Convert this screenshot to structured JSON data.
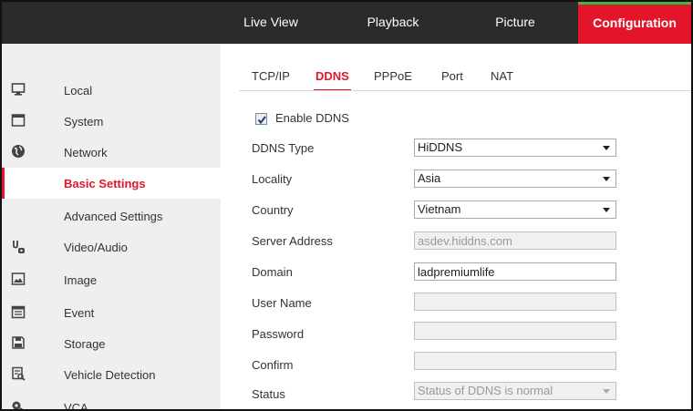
{
  "topnav": {
    "tabs": [
      {
        "label": "Live View"
      },
      {
        "label": "Playback"
      },
      {
        "label": "Picture"
      },
      {
        "label": "Configuration"
      }
    ],
    "active_color": "#e4152a"
  },
  "sidebar": {
    "items": [
      {
        "label": "Local",
        "icon": "monitor-icon"
      },
      {
        "label": "System",
        "icon": "system-icon"
      },
      {
        "label": "Network",
        "icon": "globe-icon"
      },
      {
        "label": "Basic Settings",
        "icon": ""
      },
      {
        "label": "Advanced Settings",
        "icon": ""
      },
      {
        "label": "Video/Audio",
        "icon": "video-audio-icon"
      },
      {
        "label": "Image",
        "icon": "image-icon"
      },
      {
        "label": "Event",
        "icon": "calendar-icon"
      },
      {
        "label": "Storage",
        "icon": "storage-icon"
      },
      {
        "label": "Vehicle Detection",
        "icon": "vehicle-detection-icon"
      },
      {
        "label": "VCA",
        "icon": "vca-icon"
      }
    ]
  },
  "subtabs": [
    {
      "label": "TCP/IP"
    },
    {
      "label": "DDNS"
    },
    {
      "label": "PPPoE"
    },
    {
      "label": "Port"
    },
    {
      "label": "NAT"
    }
  ],
  "form": {
    "enable_ddns_label": "Enable DDNS",
    "enable_ddns_checked": true,
    "ddns_type_label": "DDNS Type",
    "ddns_type_value": "HiDDNS",
    "locality_label": "Locality",
    "locality_value": "Asia",
    "country_label": "Country",
    "country_value": "Vietnam",
    "server_address_label": "Server Address",
    "server_address_value": "asdev.hiddns.com",
    "domain_label": "Domain",
    "domain_value": "ladpremiumlife",
    "user_name_label": "User Name",
    "user_name_value": "",
    "password_label": "Password",
    "password_value": "",
    "confirm_label": "Confirm",
    "confirm_value": "",
    "status_label": "Status",
    "status_value": "Status of DDNS is normal"
  }
}
